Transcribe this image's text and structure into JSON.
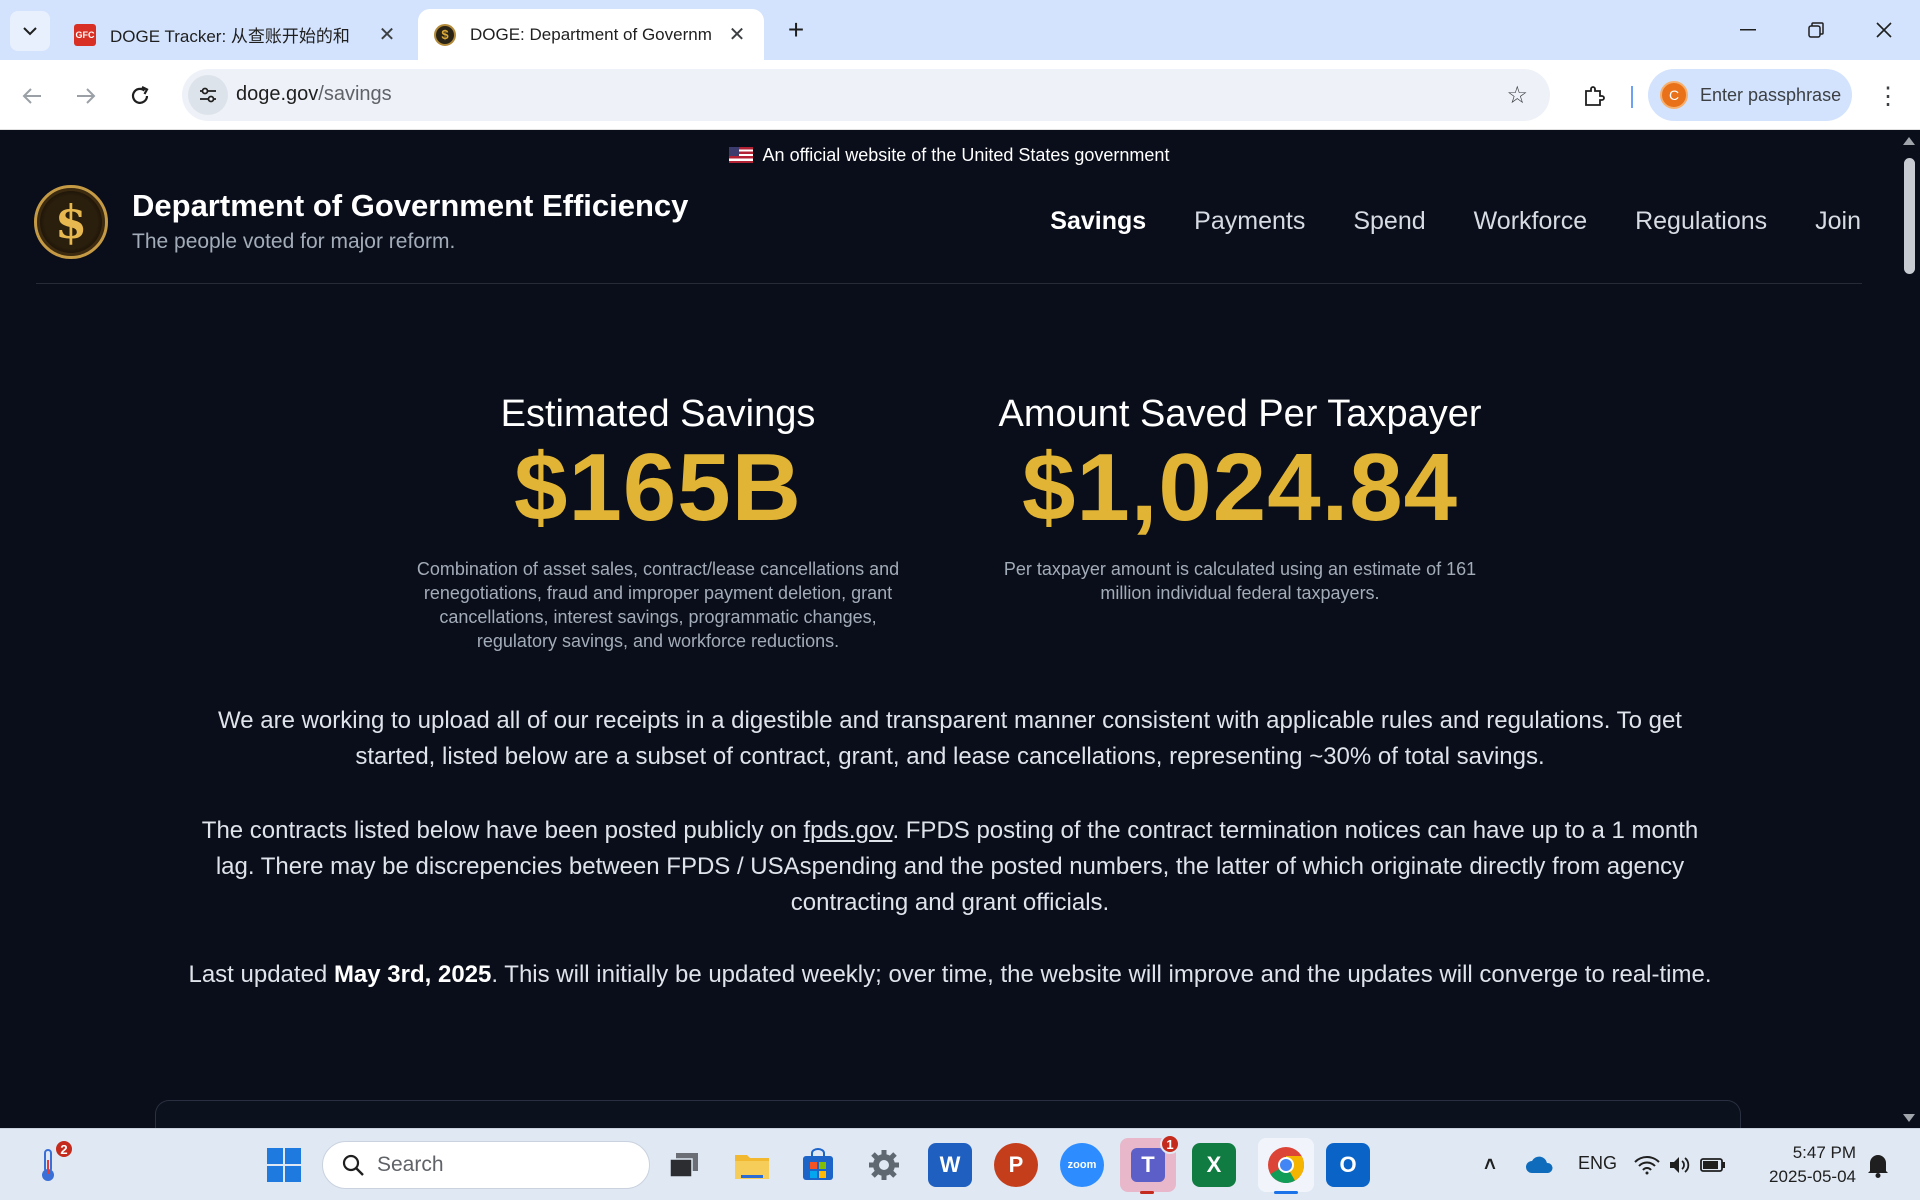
{
  "browser": {
    "tabs": [
      {
        "title": "DOGE Tracker: 从查账开始的和",
        "favicon": "GFC",
        "active": false
      },
      {
        "title": "DOGE: Department of Governm",
        "favicon": "$",
        "active": true
      }
    ],
    "url_host": "doge.gov",
    "url_path": "/savings",
    "profile_label": "Enter passphrase",
    "profile_initial": "C"
  },
  "page": {
    "gov_banner": "An official website of the United States government",
    "site_title": "Department of Government Efficiency",
    "site_tagline": "The people voted for major reform.",
    "logo_glyph": "$",
    "nav": [
      {
        "label": "Savings",
        "current": true
      },
      {
        "label": "Payments",
        "current": false
      },
      {
        "label": "Spend",
        "current": false
      },
      {
        "label": "Workforce",
        "current": false
      },
      {
        "label": "Regulations",
        "current": false
      },
      {
        "label": "Join",
        "current": false
      }
    ],
    "stats": [
      {
        "label": "Estimated Savings",
        "value": "$165B",
        "note": "Combination of asset sales, contract/lease cancellations and renegotiations, fraud and improper payment deletion, grant cancellations, interest savings, programmatic changes, regulatory savings, and workforce reductions."
      },
      {
        "label": "Amount Saved Per Taxpayer",
        "value": "$1,024.84",
        "note": "Per taxpayer amount is calculated using an estimate of 161 million individual federal taxpayers."
      }
    ],
    "intro_p1": "We are working to upload all of our receipts in a digestible and transparent manner consistent with applicable rules and regulations. To get started, listed below are a subset of contract, grant, and lease cancellations, representing ~30% of total savings.",
    "intro_p2_before": "The contracts listed below have been posted publicly on ",
    "intro_p2_link": "fpds.gov",
    "intro_p2_after": ". FPDS posting of the contract termination notices can have up to a 1 month lag. There may be discrepencies between FPDS / USAspending and the posted numbers, the latter of which originate directly from agency contracting and grant officials.",
    "intro_p3_before": "Last updated ",
    "intro_p3_date": "May 3rd, 2025",
    "intro_p3_after": ". This will initially be updated weekly; over time, the website will improve and the updates will converge to real-time."
  },
  "taskbar": {
    "search_placeholder": "Search",
    "weather_badge": "2",
    "teams_badge": "1",
    "language": "ENG",
    "time": "5:47 PM",
    "date": "2025-05-04"
  },
  "colors": {
    "accent_gold": "#e1b435",
    "page_bg": "#0a0e1a",
    "chrome_tab_bg": "#d3e3fd"
  }
}
